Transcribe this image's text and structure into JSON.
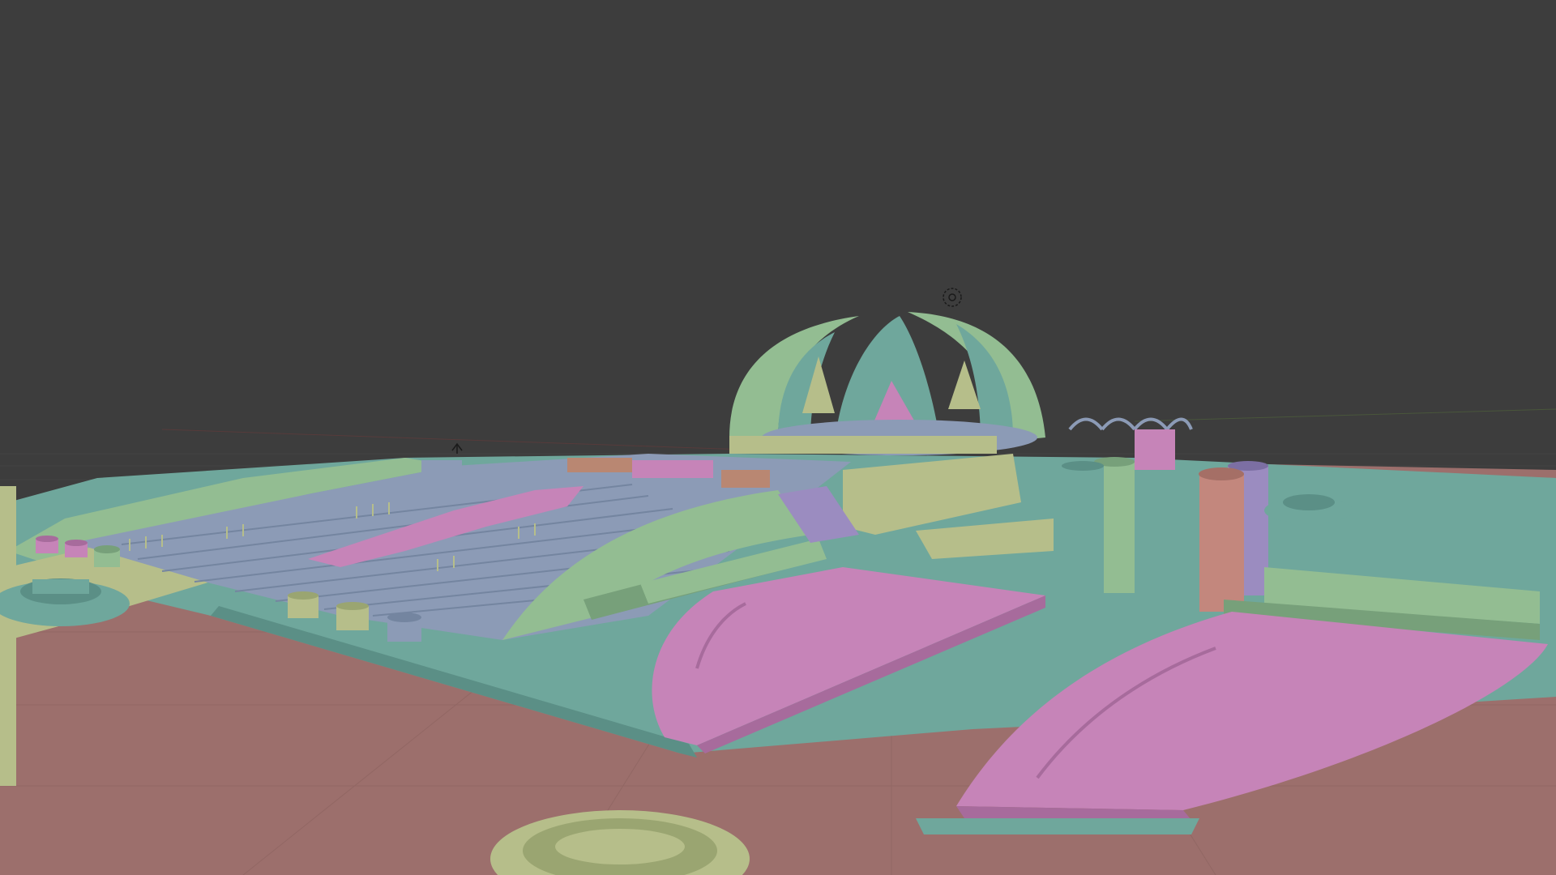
{
  "viewport": {
    "background_color": "#3d3d3d",
    "mode": "solid-shading-random-color"
  },
  "scene": {
    "subject": "monument-model",
    "palette": {
      "ground": "#9c6f6c",
      "teal": "#6fa79c",
      "teal_dark": "#5b8f86",
      "green": "#93bd92",
      "green_dark": "#77a07a",
      "olive": "#b6be8a",
      "olive_dark": "#9aa571",
      "pink": "#c684b8",
      "pink_dark": "#a76b9c",
      "blue": "#8c9bb6",
      "blue_dark": "#7485a0",
      "orange": "#b98772",
      "purple": "#9b8cc0",
      "salmon": "#c3877d"
    }
  },
  "gizmos": {
    "camera_marker": "camera-target-icon",
    "light_marker": "light-icon"
  }
}
